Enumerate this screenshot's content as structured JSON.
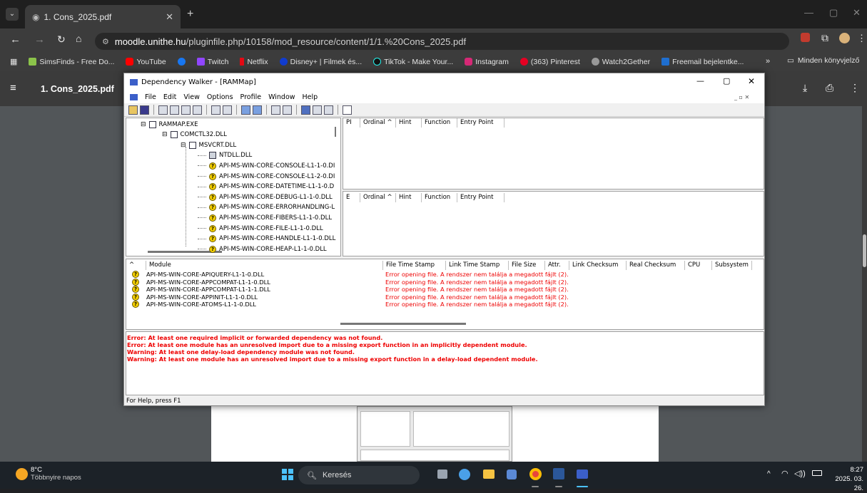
{
  "browser": {
    "tab_title": "1. Cons_2025.pdf",
    "url_host": "moodle.unithe.hu",
    "url_path": "/pluginfile.php/10158/mod_resource/content/1/1.%20Cons_2025.pdf",
    "bookmarks": [
      "SimsFinds - Free Do...",
      "YouTube",
      "Twitch",
      "Netflix",
      "Disney+ | Filmek és...",
      "TikTok - Make Your...",
      "Instagram",
      "(363) Pinterest",
      "Watch2Gether",
      "Freemail bejelentke..."
    ],
    "bookmarks_overflow": "»",
    "all_bookmarks": "Minden könyvjelző"
  },
  "pdf_viewer": {
    "title": "1. Cons_2025.pdf"
  },
  "depwalker": {
    "title": "Dependency Walker - [RAMMap]",
    "menu": [
      "File",
      "Edit",
      "View",
      "Options",
      "Profile",
      "Window",
      "Help"
    ],
    "tree": [
      {
        "label": "RAMMAP.EXE",
        "level": 0,
        "icon": "module"
      },
      {
        "label": "COMCTL32.DLL",
        "level": 1,
        "icon": "module"
      },
      {
        "label": "MSVCRT.DLL",
        "level": 2,
        "icon": "module"
      },
      {
        "label": "NTDLL.DLL",
        "level": 3,
        "icon": "module"
      },
      {
        "label": "API-MS-WIN-CORE-CONSOLE-L1-1-0.DI",
        "level": 3,
        "icon": "missing"
      },
      {
        "label": "API-MS-WIN-CORE-CONSOLE-L1-2-0.DI",
        "level": 3,
        "icon": "missing"
      },
      {
        "label": "API-MS-WIN-CORE-DATETIME-L1-1-0.D",
        "level": 3,
        "icon": "missing"
      },
      {
        "label": "API-MS-WIN-CORE-DEBUG-L1-1-0.DLL",
        "level": 3,
        "icon": "missing"
      },
      {
        "label": "API-MS-WIN-CORE-ERRORHANDLING-L",
        "level": 3,
        "icon": "missing"
      },
      {
        "label": "API-MS-WIN-CORE-FIBERS-L1-1-0.DLL",
        "level": 3,
        "icon": "missing"
      },
      {
        "label": "API-MS-WIN-CORE-FILE-L1-1-0.DLL",
        "level": 3,
        "icon": "missing"
      },
      {
        "label": "API-MS-WIN-CORE-HANDLE-L1-1-0.DLL",
        "level": 3,
        "icon": "missing"
      },
      {
        "label": "API-MS-WIN-CORE-HEAP-L1-1-0.DLL",
        "level": 3,
        "icon": "missing"
      }
    ],
    "import_headers": [
      "PI",
      "Ordinal ^",
      "Hint",
      "Function",
      "Entry Point"
    ],
    "export_headers": [
      "E",
      "Ordinal ^",
      "Hint",
      "Function",
      "Entry Point"
    ],
    "module_headers": [
      "^",
      "Module",
      "File Time Stamp",
      "Link Time Stamp",
      "File Size",
      "Attr.",
      "Link Checksum",
      "Real Checksum",
      "CPU",
      "Subsystem"
    ],
    "modules": [
      {
        "name": "API-MS-WIN-CORE-APIQUERY-L1-1-0.DLL",
        "status": "Error opening file. A rendszer nem találja a megadott fájlt (2)."
      },
      {
        "name": "API-MS-WIN-CORE-APPCOMPAT-L1-1-0.DLL",
        "status": "Error opening file. A rendszer nem találja a megadott fájlt (2)."
      },
      {
        "name": "API-MS-WIN-CORE-APPCOMPAT-L1-1-1.DLL",
        "status": "Error opening file. A rendszer nem találja a megadott fájlt (2)."
      },
      {
        "name": "API-MS-WIN-CORE-APPINIT-L1-1-0.DLL",
        "status": "Error opening file. A rendszer nem találja a megadott fájlt (2)."
      },
      {
        "name": "API-MS-WIN-CORE-ATOMS-L1-1-0.DLL",
        "status": "Error opening file. A rendszer nem találja a megadott fájlt (2)."
      }
    ],
    "log": [
      "Error: At least one required implicit or forwarded dependency was not found.",
      "Error: At least one module has an unresolved import due to a missing export function in an implicitly dependent module.",
      "Warning: At least one delay-load dependency module was not found.",
      "Warning: At least one module has an unresolved import due to a missing export function in a delay-load dependent module."
    ],
    "status": "For Help, press F1"
  },
  "taskbar": {
    "weather_temp": "8°C",
    "weather_desc": "Többnyire napos",
    "search_placeholder": "Keresés",
    "time": "8:27",
    "date": "2025. 03. 26."
  },
  "colors": {
    "accent": "#0078d4",
    "error": "#e00000",
    "youtube": "#ff0000",
    "pinterest": "#e60023"
  }
}
